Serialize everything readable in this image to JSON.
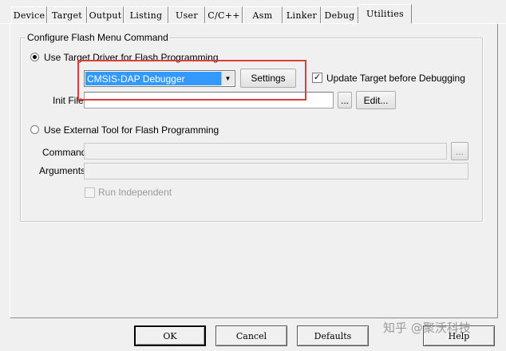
{
  "tabs": [
    {
      "label": "Device"
    },
    {
      "label": "Target"
    },
    {
      "label": "Output"
    },
    {
      "label": "Listing"
    },
    {
      "label": "User"
    },
    {
      "label": "C/C++"
    },
    {
      "label": "Asm"
    },
    {
      "label": "Linker"
    },
    {
      "label": "Debug"
    },
    {
      "label": "Utilities",
      "active": true
    }
  ],
  "group_title": "Configure Flash Menu Command",
  "target_driver": {
    "radio_label": "Use Target Driver for Flash Programming",
    "selected": true,
    "driver_value": "CMSIS-DAP Debugger",
    "settings_label": "Settings",
    "update_target_label": "Update Target before Debugging",
    "update_target_checked": true,
    "init_file_label": "Init File:",
    "init_file_value": "",
    "browse_label": "...",
    "edit_label": "Edit..."
  },
  "external_tool": {
    "radio_label": "Use External Tool for Flash Programming",
    "selected": false,
    "command_label": "Command:",
    "command_value": "",
    "browse_label": "...",
    "arguments_label": "Arguments:",
    "arguments_value": "",
    "run_independent_label": "Run Independent",
    "run_independent_checked": false
  },
  "dialog_buttons": {
    "ok": "OK",
    "cancel": "Cancel",
    "defaults": "Defaults",
    "help": "Help"
  },
  "watermark": "知乎 @聚沃科技",
  "colors": {
    "selection": "#3399ff",
    "highlight_box": "#e03a3a",
    "background": "#f0f0f0"
  }
}
